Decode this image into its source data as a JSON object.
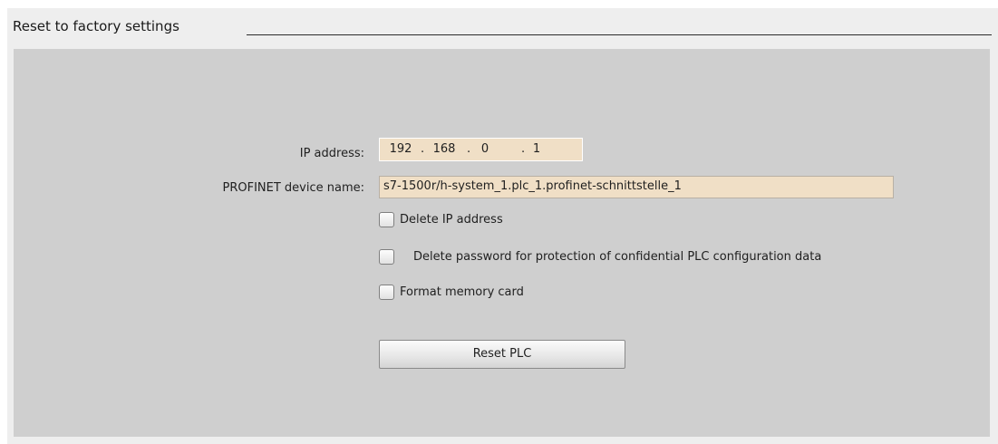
{
  "section": {
    "title": "Reset to factory settings"
  },
  "form": {
    "ip_label": "IP address:",
    "ip": {
      "octet1": "192",
      "octet2": "168",
      "octet3": "0",
      "octet4": "1",
      "separator": "."
    },
    "device_name_label": "PROFINET device name:",
    "device_name_value": "s7-1500r/h-system_1.plc_1.profinet-schnittstelle_1"
  },
  "options": {
    "delete_ip_label": "Delete IP address",
    "delete_ip_checked": false,
    "delete_password_label": "Delete password for protection of confidential PLC configuration data",
    "delete_password_checked": false,
    "format_card_label": "Format memory card",
    "format_card_checked": false
  },
  "actions": {
    "reset_label": "Reset PLC"
  }
}
